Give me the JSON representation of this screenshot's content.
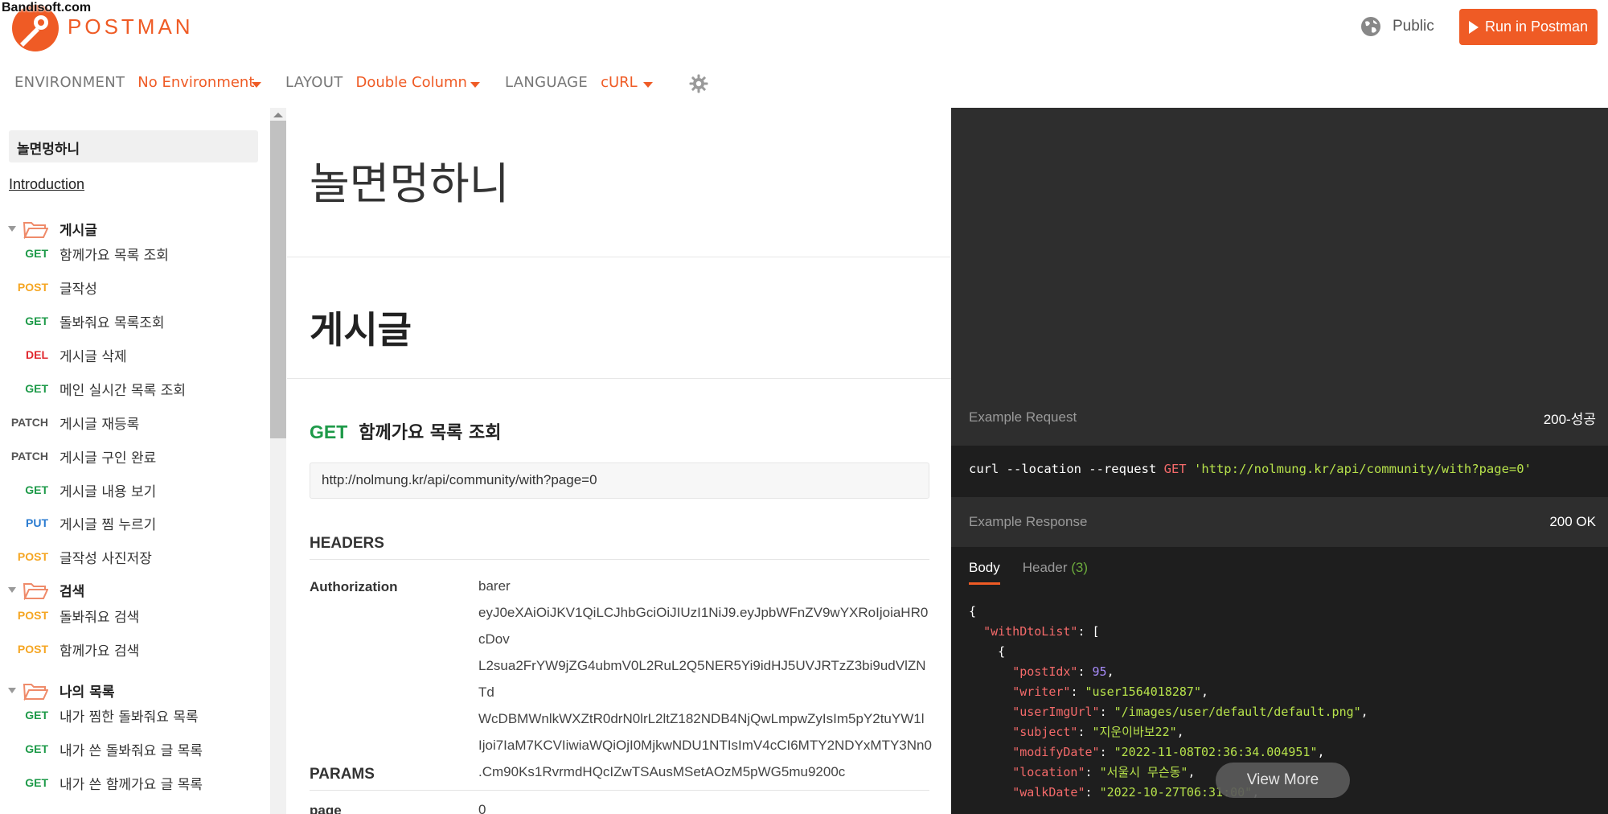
{
  "watermark": "Bandisoft.com",
  "header": {
    "logo_text": "POSTMAN",
    "visibility": "Public",
    "run_button": "Run in Postman"
  },
  "settings": {
    "environment": {
      "label": "ENVIRONMENT",
      "value": "No Environment"
    },
    "layout": {
      "label": "LAYOUT",
      "value": "Double Column"
    },
    "language": {
      "label": "LANGUAGE",
      "value": "cURL"
    }
  },
  "colors": {
    "accent": "#ef5b25",
    "get": "#1e9a49",
    "post": "#f5a623",
    "delete": "#e0282e",
    "put": "#2a7bd0"
  },
  "sidebar": {
    "collection": "놀면멍하니",
    "introduction": "Introduction",
    "folders": [
      {
        "name": "게시글",
        "items": [
          {
            "method": "GET",
            "name": "함께가요 목록 조회"
          },
          {
            "method": "POST",
            "name": "글작성"
          },
          {
            "method": "GET",
            "name": "돌봐줘요 목록조회"
          },
          {
            "method": "DEL",
            "name": "게시글 삭제"
          },
          {
            "method": "GET",
            "name": "메인 실시간 목록 조회"
          },
          {
            "method": "PATCH",
            "name": "게시글 재등록"
          },
          {
            "method": "PATCH",
            "name": "게시글 구인 완료"
          },
          {
            "method": "GET",
            "name": "게시글 내용 보기"
          },
          {
            "method": "PUT",
            "name": "게시글 찜 누르기"
          },
          {
            "method": "POST",
            "name": "글작성 사진저장"
          }
        ]
      },
      {
        "name": "검색",
        "items": [
          {
            "method": "POST",
            "name": "돌봐줘요 검색"
          },
          {
            "method": "POST",
            "name": "함께가요 검색"
          }
        ]
      },
      {
        "name": "나의 목록",
        "items": [
          {
            "method": "GET",
            "name": "내가 찜한 돌봐줘요 목록"
          },
          {
            "method": "GET",
            "name": "내가 쓴 돌봐줘요 글 목록"
          },
          {
            "method": "GET",
            "name": "내가 쓴 함께가요 글 목록"
          }
        ]
      }
    ]
  },
  "main": {
    "title": "놀면멍하니",
    "folder_title": "게시글",
    "request": {
      "method": "GET",
      "name": "함께가요 목록 조회",
      "url": "http://nolmung.kr/api/community/with?page=0",
      "headers_title": "HEADERS",
      "header_key": "Authorization",
      "header_value_lines": [
        "barer",
        "eyJ0eXAiOiJKV1QiLCJhbGciOiJIUzI1NiJ9.eyJpbWFnZV9wYXRoIjoiaHR0cDov",
        "L2sua2FrYW9jZG4ubmV0L2RuL2Q5NER5Yi9idHJ5UVJRTzZ3bi9udVlZNTd",
        "WcDBMWnlkWXZtR0drN0lrL2ltZ182NDB4NjQwLmpwZyIsIm5pY2tuYW1l",
        "Ijoi7IaM7KCVIiwiaWQiOjI0MjkwNDU1NTIsImV4cCI6MTY2NDYxMTY3Nn0",
        ".Cm90Ks1RvrmdHQcIZwTSAusMSetAOzM5pWG5mu9200c"
      ],
      "params_title": "PARAMS",
      "param_key": "page",
      "param_value": "0"
    }
  },
  "right": {
    "example_request_label": "Example Request",
    "example_request_name": "200-성공",
    "curl_prefix": "curl --location --request",
    "curl_method": "GET",
    "curl_url": "'http://nolmung.kr/api/community/with?page=0'",
    "example_response_label": "Example Response",
    "response_status": "200 OK",
    "tab_body": "Body",
    "tab_header": "Header",
    "tab_header_count": "(3)",
    "json_lines": [
      {
        "t": "{"
      },
      {
        "indent": "  ",
        "k": "withDtoList",
        "rest": "[",
        "type": "raw"
      },
      {
        "t": "    {"
      },
      {
        "indent": "      ",
        "k": "postIdx",
        "v": "95",
        "type": "num"
      },
      {
        "indent": "      ",
        "k": "writer",
        "v": "\"user1564018287\"",
        "type": "str"
      },
      {
        "indent": "      ",
        "k": "userImgUrl",
        "v": "\"/images/user/default/default.png\"",
        "type": "str"
      },
      {
        "indent": "      ",
        "k": "subject",
        "v": "\"지운이바보22\"",
        "type": "str"
      },
      {
        "indent": "      ",
        "k": "modifyDate",
        "v": "\"2022-11-08T02:36:34.004951\"",
        "type": "str"
      },
      {
        "indent": "      ",
        "k": "location",
        "v": "\"서울시 무슨동\"",
        "type": "str"
      },
      {
        "indent": "      ",
        "k": "walkDate",
        "v": "\"2022-10-27T06:31:00\"",
        "type": "str"
      }
    ],
    "view_more": "View More"
  }
}
